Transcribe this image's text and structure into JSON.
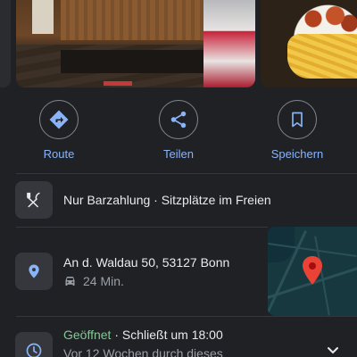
{
  "photos": {
    "items": [
      "photo-interior",
      "photo-fries"
    ]
  },
  "actions": [
    {
      "label": "Route",
      "icon": "directions-icon"
    },
    {
      "label": "Teilen",
      "icon": "share-icon"
    },
    {
      "label": "Speichern",
      "icon": "bookmark-icon"
    }
  ],
  "services": {
    "text": "Nur Barzahlung · Sitzplätze im Freien",
    "icon": "restaurant-icon"
  },
  "address": {
    "text": "An d. Waldau 50, 53127 Bonn",
    "drive_time": "24 Min.",
    "icon": "location-pin-icon"
  },
  "hours": {
    "status": "Geöffnet",
    "closes": " · Schließt um 18:00",
    "note": "Vor 12 Wochen durch dieses",
    "icon": "clock-icon"
  },
  "colors": {
    "background": "#1f2125",
    "accent": "#8ab4f8",
    "open_green": "#81c995",
    "pin_red": "#ea4335"
  }
}
